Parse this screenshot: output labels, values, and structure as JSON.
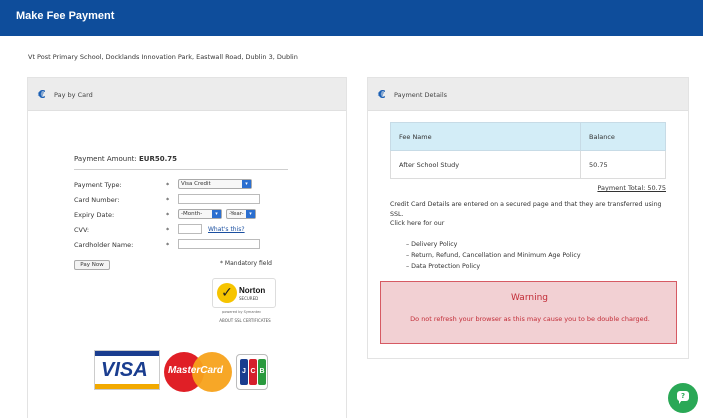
{
  "header": {
    "title": "Make Fee Payment"
  },
  "address": "Vt Post Primary School, Docklands Innovation Park, Eastwall Road, Dublin 3, Dublin",
  "left_panel": {
    "icon": "euro-icon",
    "title": "Pay by Card",
    "payment_amount_label": "Payment Amount:",
    "payment_amount_value": "EUR50.75",
    "fields": {
      "payment_type": {
        "label": "Payment Type:",
        "required": "*",
        "value": "Visa Credit"
      },
      "card_number": {
        "label": "Card Number:",
        "required": "*"
      },
      "expiry_date": {
        "label": "Expiry Date:",
        "required": "*",
        "month": "-Month-",
        "year": "-Year-"
      },
      "cvv": {
        "label": "CVV:",
        "required": "*",
        "help_link": "What's this?"
      },
      "cardholder_name": {
        "label": "Cardholder Name:",
        "required": "*"
      }
    },
    "pay_now_label": "Pay Now",
    "mandatory_note": "* Mandatory field",
    "norton": {
      "name": "Norton",
      "secured": "SECURED",
      "by": "powered by Symantec",
      "about": "ABOUT SSL CERTIFICATES"
    },
    "card_logos": {
      "visa": "VISA",
      "mastercard": "MasterCard",
      "jcb": [
        "J",
        "C",
        "B"
      ]
    }
  },
  "right_panel": {
    "icon": "euro-icon",
    "title": "Payment Details",
    "table": {
      "headers": [
        "Fee Name",
        "Balance"
      ],
      "rows": [
        [
          "After School Study",
          "50.75"
        ]
      ]
    },
    "payment_total": "Payment Total: 50.75",
    "info_text": "Credit Card Details are entered on a secured page and that they are transferred using SSL.",
    "click_here": "Click here for our",
    "policies": [
      "Delivery Policy",
      "Return, Refund, Cancellation and Minimum Age Policy",
      "Data Protection Policy"
    ],
    "warning": {
      "title": "Warning",
      "message": "Do not refresh your browser as this may cause you to be double charged."
    }
  },
  "chat": {
    "icon": "chat-icon",
    "glyph": "?"
  },
  "colors": {
    "header_bg": "#0e4d9b",
    "table_header_bg": "#d3edf7",
    "warning_bg": "#f2d0d3",
    "warning_text": "#c22c37",
    "chat_green": "#2aa856"
  }
}
